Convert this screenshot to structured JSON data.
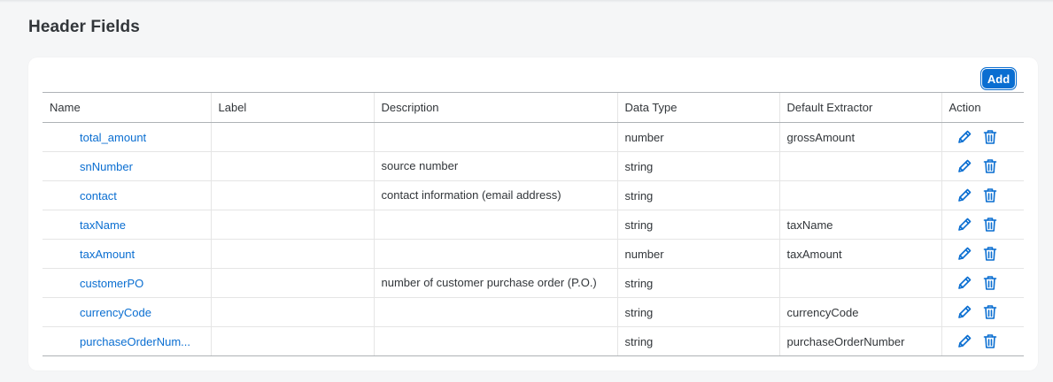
{
  "page": {
    "title": "Header Fields"
  },
  "toolbar": {
    "add_label": "Add"
  },
  "table": {
    "columns": [
      "Name",
      "Label",
      "Description",
      "Data Type",
      "Default Extractor",
      "Action"
    ],
    "rows": [
      {
        "name": "total_amount",
        "label": "",
        "description": "",
        "data_type": "number",
        "default_extractor": "grossAmount"
      },
      {
        "name": "snNumber",
        "label": "",
        "description": "source number",
        "data_type": "string",
        "default_extractor": ""
      },
      {
        "name": "contact",
        "label": "",
        "description": "contact information (email address)",
        "data_type": "string",
        "default_extractor": ""
      },
      {
        "name": "taxName",
        "label": "",
        "description": "",
        "data_type": "string",
        "default_extractor": "taxName"
      },
      {
        "name": "taxAmount",
        "label": "",
        "description": "",
        "data_type": "number",
        "default_extractor": "taxAmount"
      },
      {
        "name": "customerPO",
        "label": "",
        "description": "number of customer purchase order (P.O.)",
        "data_type": "string",
        "default_extractor": ""
      },
      {
        "name": "currencyCode",
        "label": "",
        "description": "",
        "data_type": "string",
        "default_extractor": "currencyCode"
      },
      {
        "name": "purchaseOrderNum...",
        "label": "",
        "description": "",
        "data_type": "string",
        "default_extractor": "purchaseOrderNumber"
      }
    ],
    "actions": {
      "edit_icon": "pencil-edit-icon",
      "delete_icon": "trash-delete-icon"
    }
  },
  "colors": {
    "accent": "#0a6ed1",
    "background": "#f5f6f7",
    "text": "#32363a"
  }
}
